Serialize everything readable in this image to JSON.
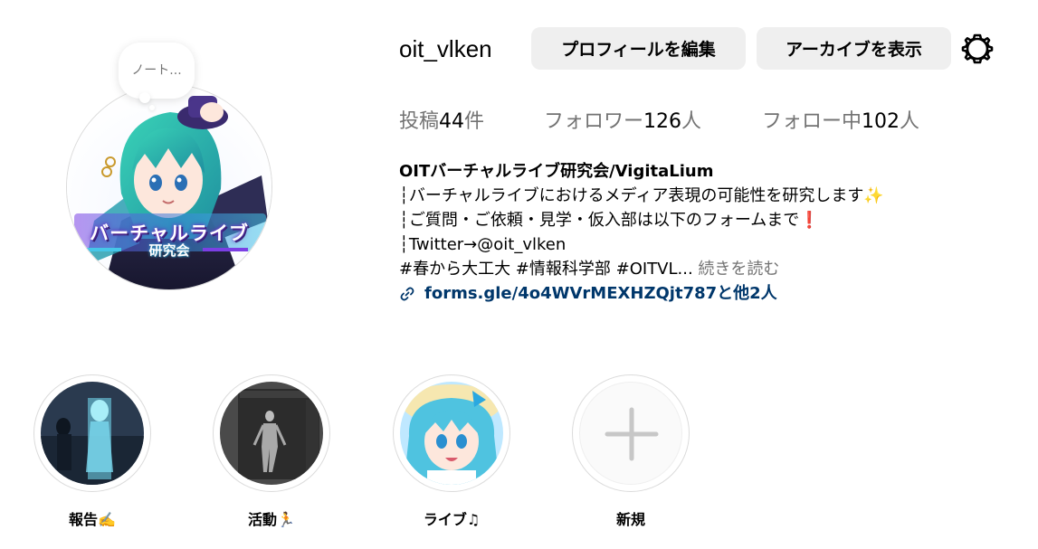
{
  "profile": {
    "username": "oit_vlken",
    "note": "ノート...",
    "avatar_caption": "バーチャルライブ",
    "avatar_caption_sub": "研究会",
    "buttons": {
      "edit_profile": "プロフィールを編集",
      "view_archive": "アーカイブを表示"
    },
    "settings_icon": "gear-icon"
  },
  "stats": {
    "posts_prefix": "投稿",
    "posts_count": "44",
    "posts_suffix": "件",
    "followers_prefix": "フォロワー",
    "followers_count": "126",
    "followers_suffix": "人",
    "following_prefix": "フォロー中",
    "following_count": "102",
    "following_suffix": "人"
  },
  "bio": {
    "name": "OITバーチャルライブ研究会/VigitaLium",
    "line1": "┆バーチャルライブにおけるメディア表現の可能性を研究します",
    "line1_emoji": "✨",
    "line2": "┆ご質問・ご依頼・見学・仮入部は以下のフォームまで",
    "line2_emoji": "❗",
    "line3": "┆Twitter→@oit_vlken",
    "line4": "#春から大工大 #情報科学部 #OITVL...",
    "more": " 続きを読む",
    "link": "forms.gle/4o4WVrMEXHZQjt787と他2人",
    "link_icon": "link-icon"
  },
  "highlights": [
    {
      "label": "報告✍️"
    },
    {
      "label": "活動🏃"
    },
    {
      "label": "ライブ♫"
    },
    {
      "label": "新規",
      "icon": "plus-icon"
    }
  ],
  "colors": {
    "button_bg": "#efefef",
    "muted_text": "#737373",
    "link": "#00376b",
    "border": "#dbdbdb"
  }
}
